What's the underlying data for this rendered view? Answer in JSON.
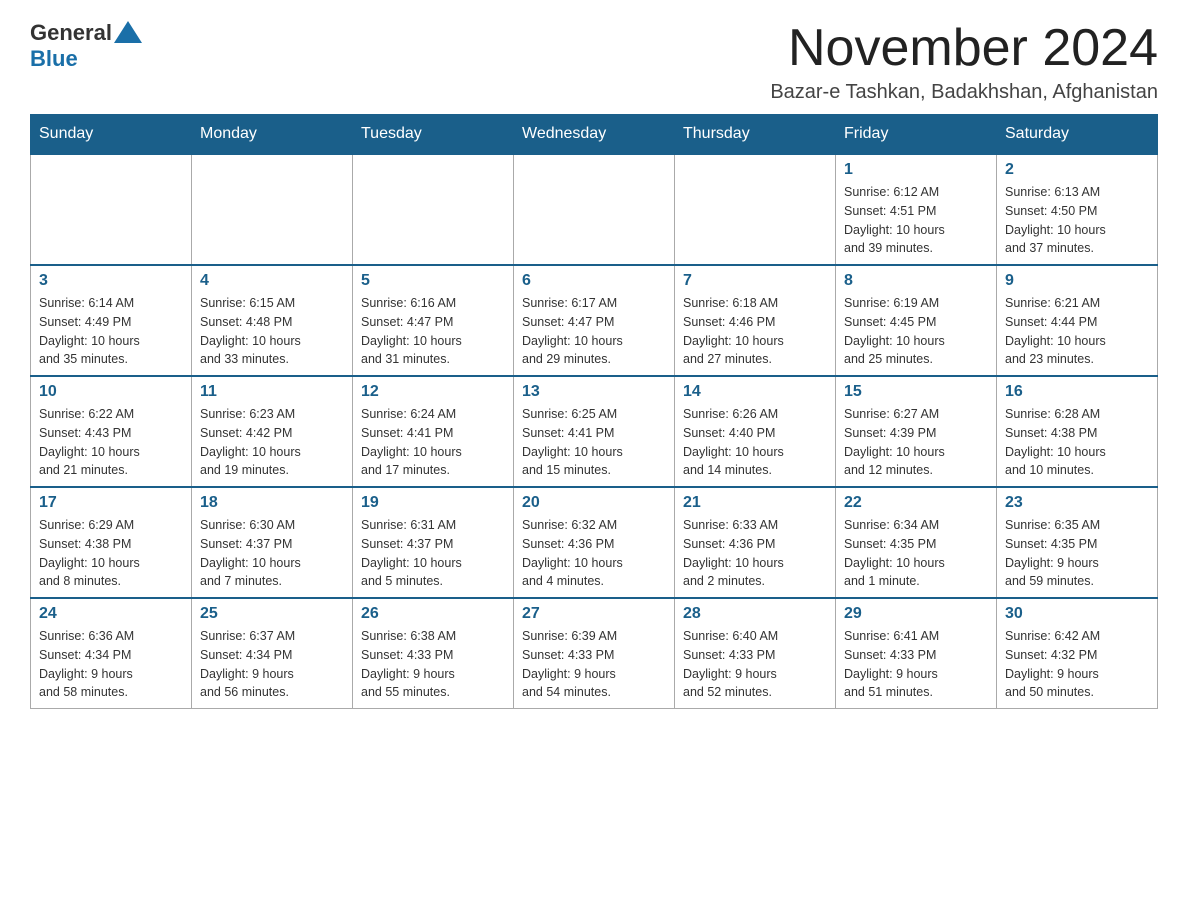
{
  "header": {
    "logo_general": "General",
    "logo_blue": "Blue",
    "month_title": "November 2024",
    "location": "Bazar-e Tashkan, Badakhshan, Afghanistan"
  },
  "weekdays": [
    "Sunday",
    "Monday",
    "Tuesday",
    "Wednesday",
    "Thursday",
    "Friday",
    "Saturday"
  ],
  "weeks": [
    [
      {
        "day": "",
        "info": ""
      },
      {
        "day": "",
        "info": ""
      },
      {
        "day": "",
        "info": ""
      },
      {
        "day": "",
        "info": ""
      },
      {
        "day": "",
        "info": ""
      },
      {
        "day": "1",
        "info": "Sunrise: 6:12 AM\nSunset: 4:51 PM\nDaylight: 10 hours\nand 39 minutes."
      },
      {
        "day": "2",
        "info": "Sunrise: 6:13 AM\nSunset: 4:50 PM\nDaylight: 10 hours\nand 37 minutes."
      }
    ],
    [
      {
        "day": "3",
        "info": "Sunrise: 6:14 AM\nSunset: 4:49 PM\nDaylight: 10 hours\nand 35 minutes."
      },
      {
        "day": "4",
        "info": "Sunrise: 6:15 AM\nSunset: 4:48 PM\nDaylight: 10 hours\nand 33 minutes."
      },
      {
        "day": "5",
        "info": "Sunrise: 6:16 AM\nSunset: 4:47 PM\nDaylight: 10 hours\nand 31 minutes."
      },
      {
        "day": "6",
        "info": "Sunrise: 6:17 AM\nSunset: 4:47 PM\nDaylight: 10 hours\nand 29 minutes."
      },
      {
        "day": "7",
        "info": "Sunrise: 6:18 AM\nSunset: 4:46 PM\nDaylight: 10 hours\nand 27 minutes."
      },
      {
        "day": "8",
        "info": "Sunrise: 6:19 AM\nSunset: 4:45 PM\nDaylight: 10 hours\nand 25 minutes."
      },
      {
        "day": "9",
        "info": "Sunrise: 6:21 AM\nSunset: 4:44 PM\nDaylight: 10 hours\nand 23 minutes."
      }
    ],
    [
      {
        "day": "10",
        "info": "Sunrise: 6:22 AM\nSunset: 4:43 PM\nDaylight: 10 hours\nand 21 minutes."
      },
      {
        "day": "11",
        "info": "Sunrise: 6:23 AM\nSunset: 4:42 PM\nDaylight: 10 hours\nand 19 minutes."
      },
      {
        "day": "12",
        "info": "Sunrise: 6:24 AM\nSunset: 4:41 PM\nDaylight: 10 hours\nand 17 minutes."
      },
      {
        "day": "13",
        "info": "Sunrise: 6:25 AM\nSunset: 4:41 PM\nDaylight: 10 hours\nand 15 minutes."
      },
      {
        "day": "14",
        "info": "Sunrise: 6:26 AM\nSunset: 4:40 PM\nDaylight: 10 hours\nand 14 minutes."
      },
      {
        "day": "15",
        "info": "Sunrise: 6:27 AM\nSunset: 4:39 PM\nDaylight: 10 hours\nand 12 minutes."
      },
      {
        "day": "16",
        "info": "Sunrise: 6:28 AM\nSunset: 4:38 PM\nDaylight: 10 hours\nand 10 minutes."
      }
    ],
    [
      {
        "day": "17",
        "info": "Sunrise: 6:29 AM\nSunset: 4:38 PM\nDaylight: 10 hours\nand 8 minutes."
      },
      {
        "day": "18",
        "info": "Sunrise: 6:30 AM\nSunset: 4:37 PM\nDaylight: 10 hours\nand 7 minutes."
      },
      {
        "day": "19",
        "info": "Sunrise: 6:31 AM\nSunset: 4:37 PM\nDaylight: 10 hours\nand 5 minutes."
      },
      {
        "day": "20",
        "info": "Sunrise: 6:32 AM\nSunset: 4:36 PM\nDaylight: 10 hours\nand 4 minutes."
      },
      {
        "day": "21",
        "info": "Sunrise: 6:33 AM\nSunset: 4:36 PM\nDaylight: 10 hours\nand 2 minutes."
      },
      {
        "day": "22",
        "info": "Sunrise: 6:34 AM\nSunset: 4:35 PM\nDaylight: 10 hours\nand 1 minute."
      },
      {
        "day": "23",
        "info": "Sunrise: 6:35 AM\nSunset: 4:35 PM\nDaylight: 9 hours\nand 59 minutes."
      }
    ],
    [
      {
        "day": "24",
        "info": "Sunrise: 6:36 AM\nSunset: 4:34 PM\nDaylight: 9 hours\nand 58 minutes."
      },
      {
        "day": "25",
        "info": "Sunrise: 6:37 AM\nSunset: 4:34 PM\nDaylight: 9 hours\nand 56 minutes."
      },
      {
        "day": "26",
        "info": "Sunrise: 6:38 AM\nSunset: 4:33 PM\nDaylight: 9 hours\nand 55 minutes."
      },
      {
        "day": "27",
        "info": "Sunrise: 6:39 AM\nSunset: 4:33 PM\nDaylight: 9 hours\nand 54 minutes."
      },
      {
        "day": "28",
        "info": "Sunrise: 6:40 AM\nSunset: 4:33 PM\nDaylight: 9 hours\nand 52 minutes."
      },
      {
        "day": "29",
        "info": "Sunrise: 6:41 AM\nSunset: 4:33 PM\nDaylight: 9 hours\nand 51 minutes."
      },
      {
        "day": "30",
        "info": "Sunrise: 6:42 AM\nSunset: 4:32 PM\nDaylight: 9 hours\nand 50 minutes."
      }
    ]
  ]
}
